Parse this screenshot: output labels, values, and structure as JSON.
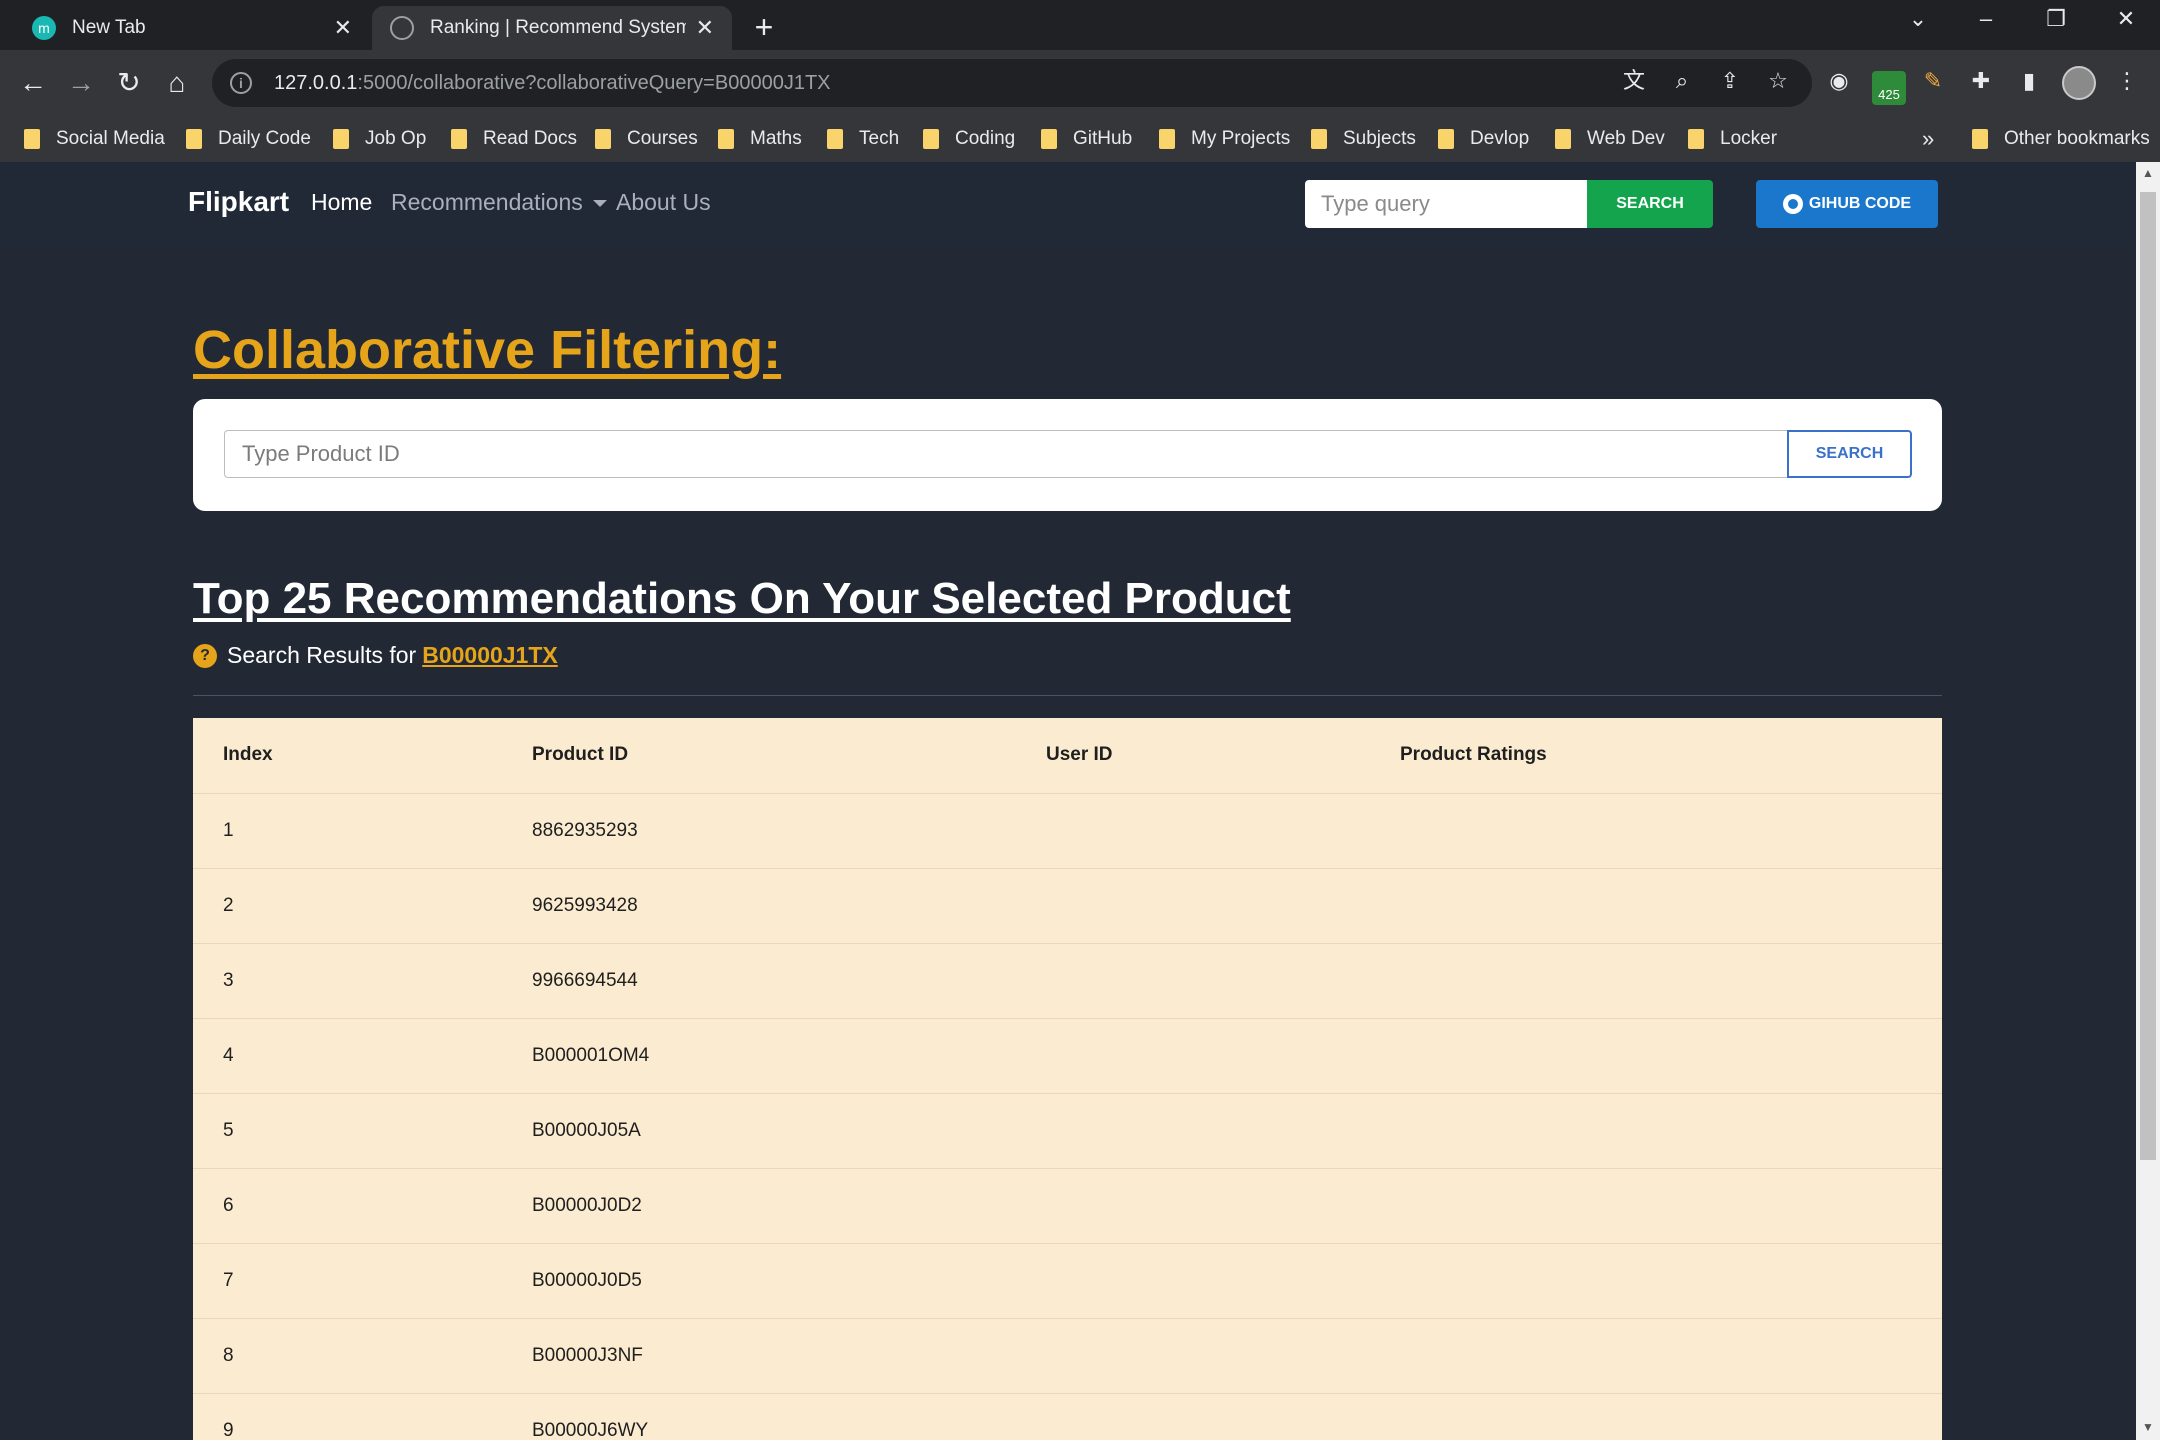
{
  "browser": {
    "tabs": [
      {
        "title": "New Tab",
        "icon": "m"
      },
      {
        "title": "Ranking | Recommend System",
        "icon": "globe"
      }
    ],
    "url_host": "127.0.0.1",
    "url_rest": ":5000/collaborative?collaborativeQuery=B00000J1TX",
    "extension_badge": "425",
    "bookmarks": [
      "Social Media",
      "Daily Code",
      "Job Op",
      "Read Docs",
      "Courses",
      "Maths",
      "Tech",
      "Coding",
      "GitHub",
      "My Projects",
      "Subjects",
      "Devlop",
      "Web Dev",
      "Locker"
    ],
    "more_bookmarks": "»",
    "other_bookmarks": "Other bookmarks"
  },
  "navbar": {
    "brand": "Flipkart",
    "home": "Home",
    "recommendations": "Recommendations",
    "about": "About Us",
    "search_placeholder": "Type query",
    "search_button": "SEARCH",
    "github_button": "GIHUB CODE"
  },
  "main": {
    "heading": "Collaborative Filtering:",
    "product_placeholder": "Type Product ID",
    "product_button": "SEARCH",
    "subheading": "Top 25 Recommendations On Your Selected Product",
    "results_prefix": "Search Results for",
    "query": "B00000J1TX",
    "question_icon": "?"
  },
  "table": {
    "headers": [
      "Index",
      "Product ID",
      "User ID",
      "Product Ratings"
    ],
    "rows": [
      {
        "index": "1",
        "product_id": "8862935293",
        "user_id": "",
        "rating": ""
      },
      {
        "index": "2",
        "product_id": "9625993428",
        "user_id": "",
        "rating": ""
      },
      {
        "index": "3",
        "product_id": "9966694544",
        "user_id": "",
        "rating": ""
      },
      {
        "index": "4",
        "product_id": "B000001OM4",
        "user_id": "",
        "rating": ""
      },
      {
        "index": "5",
        "product_id": "B00000J05A",
        "user_id": "",
        "rating": ""
      },
      {
        "index": "6",
        "product_id": "B00000J0D2",
        "user_id": "",
        "rating": ""
      },
      {
        "index": "7",
        "product_id": "B00000J0D5",
        "user_id": "",
        "rating": ""
      },
      {
        "index": "8",
        "product_id": "B00000J3NF",
        "user_id": "",
        "rating": ""
      },
      {
        "index": "9",
        "product_id": "B00000J6WY",
        "user_id": "",
        "rating": ""
      }
    ]
  },
  "colors": {
    "page_bg": "#222935",
    "accent": "#e6a41a",
    "search_green": "#14a44d",
    "github_blue": "#1a77cc",
    "table_bg": "#fbebd0"
  }
}
